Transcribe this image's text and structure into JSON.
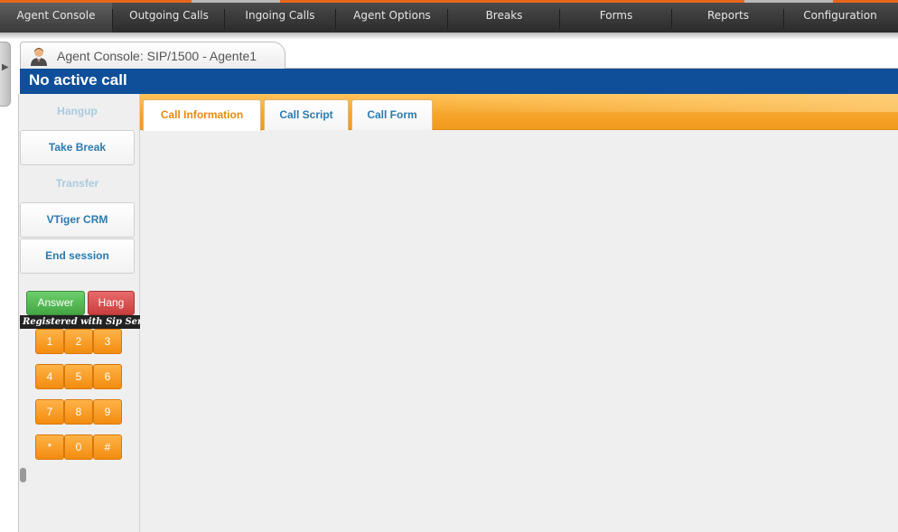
{
  "nav": {
    "items": [
      {
        "label": "Agent Console"
      },
      {
        "label": "Outgoing Calls"
      },
      {
        "label": "Ingoing Calls"
      },
      {
        "label": "Agent Options"
      },
      {
        "label": "Breaks"
      },
      {
        "label": "Forms"
      },
      {
        "label": "Reports"
      },
      {
        "label": "Configuration"
      }
    ],
    "active_index": 0,
    "accent_color": "#e8661c"
  },
  "console_tab": {
    "title": "Agent Console: SIP/1500 - Agente1",
    "icon": "agent-avatar-icon"
  },
  "status": {
    "text": "No active call",
    "color": "#0f4f9a"
  },
  "sidebar": {
    "buttons": [
      {
        "label": "Hangup",
        "enabled": false
      },
      {
        "label": "Take Break",
        "enabled": true
      },
      {
        "label": "Transfer",
        "enabled": false
      },
      {
        "label": "VTiger CRM",
        "enabled": true
      },
      {
        "label": "End session",
        "enabled": true
      }
    ],
    "phone": {
      "answer_label": "Answer",
      "hang_label": "Hang",
      "sip_status": "Registered with Sip Server",
      "keys": [
        "1",
        "2",
        "3",
        "4",
        "5",
        "6",
        "7",
        "8",
        "9",
        "*",
        "0",
        "#"
      ]
    }
  },
  "main": {
    "tabs": [
      {
        "label": "Call Information",
        "active": true
      },
      {
        "label": "Call Script",
        "active": false
      },
      {
        "label": "Call Form",
        "active": false
      }
    ]
  }
}
